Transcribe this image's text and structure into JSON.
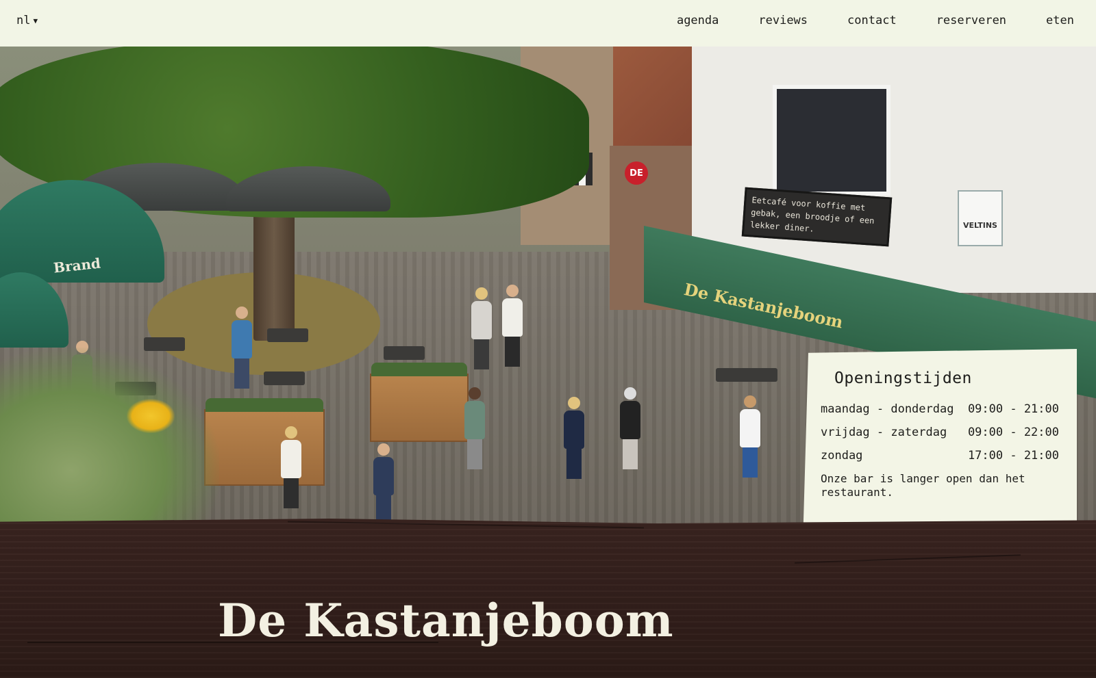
{
  "header": {
    "language": "nl",
    "nav": [
      {
        "label": "agenda"
      },
      {
        "label": "reviews"
      },
      {
        "label": "contact"
      },
      {
        "label": "reserveren"
      },
      {
        "label": "eten"
      }
    ]
  },
  "hero": {
    "chalkboard_text": "Eetcafé voor koffie met gebak, een broodje of een lekker diner.",
    "awning_text": "De Kastanjeboom",
    "umbrella_brand": "Brand",
    "sign_de": "DE",
    "sign_veltins": "VELTINS"
  },
  "hours": {
    "title": "Openingstijden",
    "rows": [
      {
        "day": "maandag - donderdag",
        "time": "09:00 - 21:00"
      },
      {
        "day": "vrijdag - zaterdag",
        "time": "09:00 - 22:00"
      },
      {
        "day": "zondag",
        "time": "17:00 - 21:00"
      }
    ],
    "note": "Onze bar is langer open dan het restaurant."
  },
  "title": "De Kastanjeboom",
  "colors": {
    "background": "#f2f5e6",
    "wood": "#2c1b17",
    "awning": "#2f6448",
    "title_text": "#f3f0e2"
  }
}
